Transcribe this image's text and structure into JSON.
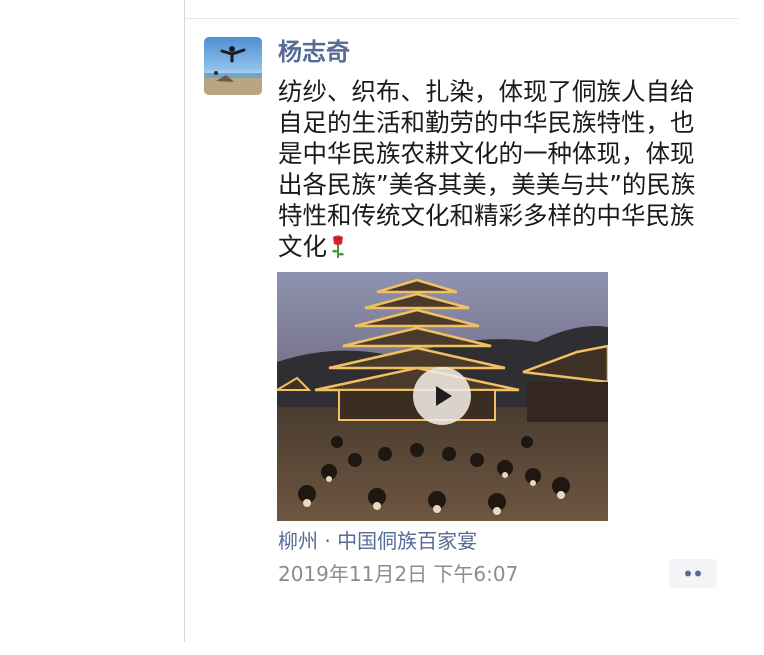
{
  "post": {
    "author": "杨志奇",
    "text": "纺纱、织布、扎染，体现了侗族人自给自足的生活和勤劳的中华民族特性，也是中华民族农耕文化的一种体现，体现出各民族”美各其美，美美与共”的民族特性和传统文化和精彩多样的中华民族文化",
    "emoji_icon": "rose-icon",
    "video_icon": "play-icon",
    "location": "柳州 · 中国侗族百家宴",
    "timestamp": "2019年11月2日 下午6:07",
    "more_icon": "more-dots-icon"
  },
  "colors": {
    "link": "#576b95",
    "body_text": "#1a1a1a",
    "meta_text": "#8c8c8c",
    "more_bg": "#f4f4f6"
  }
}
